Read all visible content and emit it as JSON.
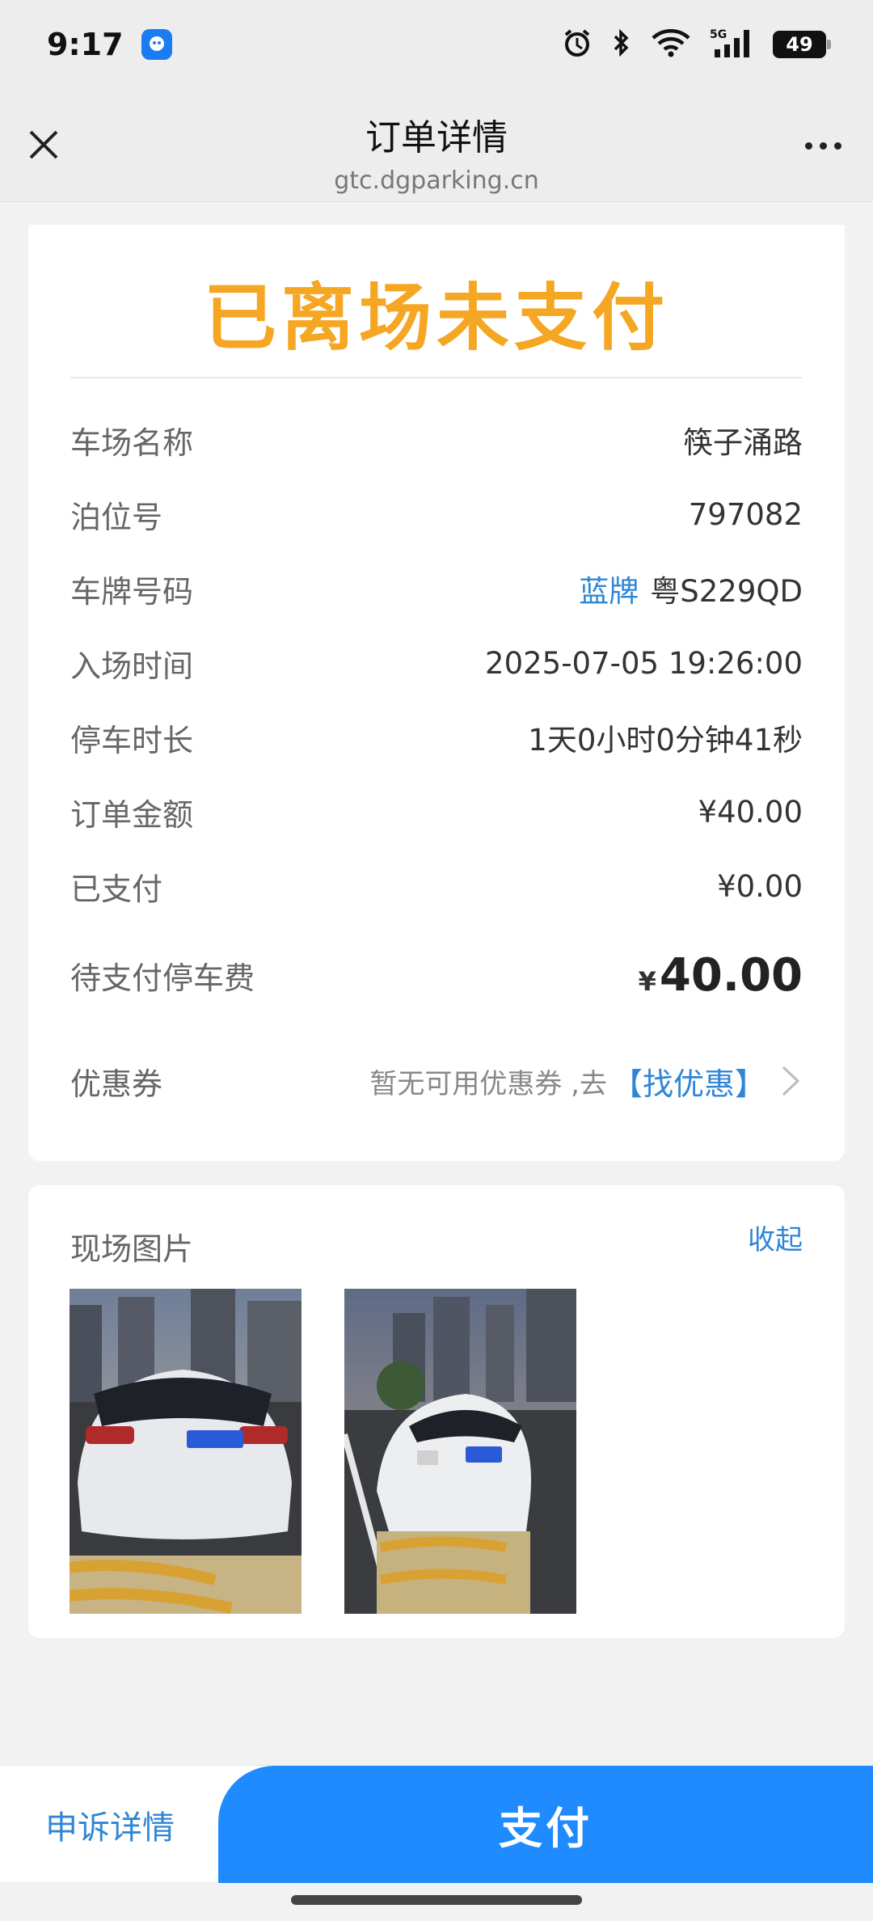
{
  "status_bar": {
    "time": "9:17",
    "battery": "49",
    "network": "5G",
    "icons": [
      "app-icon",
      "alarm-icon",
      "bluetooth-icon",
      "wifi-icon",
      "signal-icon",
      "battery-icon"
    ]
  },
  "nav": {
    "title": "订单详情",
    "url": "gtc.dgparking.cn",
    "close_icon": "close-icon",
    "more_icon": "more-icon"
  },
  "order_status": "已离场未支付",
  "details": {
    "lot_name_label": "车场名称",
    "lot_name": "筷子涌路",
    "berth_label": "泊位号",
    "berth": "797082",
    "plate_label": "车牌号码",
    "plate_type": "蓝牌",
    "plate": "粤S229QD",
    "entry_label": "入场时间",
    "entry_time": "2025-07-05 19:26:00",
    "duration_label": "停车时长",
    "duration": "1天0小时0分钟41秒",
    "amount_label": "订单金额",
    "amount": "¥40.00",
    "paid_label": "已支付",
    "paid": "¥0.00",
    "due_label": "待支付停车费",
    "due_currency": "¥",
    "due_amount": "40.00",
    "coupon_label": "优惠券",
    "coupon_text": "暂无可用优惠券 ,去",
    "coupon_link": "【找优惠】"
  },
  "photos": {
    "title": "现场图片",
    "collapse": "收起"
  },
  "bottom": {
    "appeal": "申诉详情",
    "pay": "支付"
  },
  "colors": {
    "status_orange": "#f5a623",
    "link_blue": "#2f86d6",
    "pay_blue": "#1f8bff"
  }
}
